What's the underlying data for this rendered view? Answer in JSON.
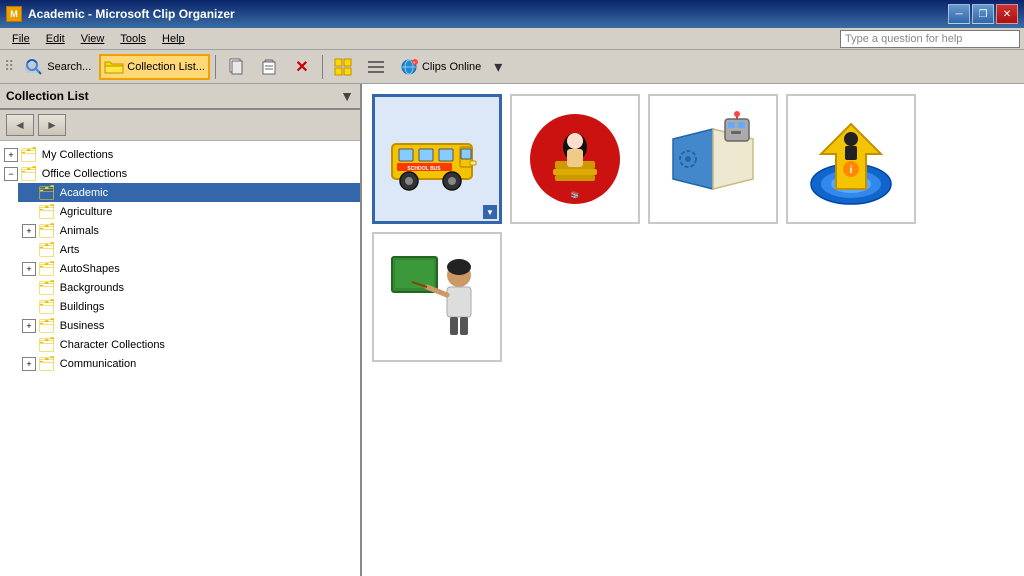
{
  "titlebar": {
    "icon_label": "M",
    "title": "Academic - Microsoft Clip Organizer",
    "minimize_label": "─",
    "restore_label": "❐",
    "close_label": "✕"
  },
  "menubar": {
    "items": [
      "File",
      "Edit",
      "View",
      "Tools",
      "Help"
    ],
    "help_placeholder": "Type a question for help"
  },
  "toolbar": {
    "search_label": "Search...",
    "collection_list_label": "Collection List...",
    "clips_online_label": "Clips Online"
  },
  "sidebar": {
    "title": "Collection List",
    "back_label": "◄",
    "forward_label": "►",
    "tree": [
      {
        "id": "my-collections",
        "label": "My Collections",
        "level": 0,
        "expanded": false,
        "has_children": true
      },
      {
        "id": "office-collections",
        "label": "Office Collections",
        "level": 0,
        "expanded": true,
        "has_children": true
      },
      {
        "id": "academic",
        "label": "Academic",
        "level": 1,
        "expanded": false,
        "has_children": false,
        "selected": true
      },
      {
        "id": "agriculture",
        "label": "Agriculture",
        "level": 1,
        "expanded": false,
        "has_children": false
      },
      {
        "id": "animals",
        "label": "Animals",
        "level": 1,
        "expanded": false,
        "has_children": true
      },
      {
        "id": "arts",
        "label": "Arts",
        "level": 1,
        "expanded": false,
        "has_children": false
      },
      {
        "id": "autoshapes",
        "label": "AutoShapes",
        "level": 1,
        "expanded": false,
        "has_children": true
      },
      {
        "id": "backgrounds",
        "label": "Backgrounds",
        "level": 1,
        "expanded": false,
        "has_children": false
      },
      {
        "id": "buildings",
        "label": "Buildings",
        "level": 1,
        "expanded": false,
        "has_children": false
      },
      {
        "id": "business",
        "label": "Business",
        "level": 1,
        "expanded": false,
        "has_children": true
      },
      {
        "id": "character-collections",
        "label": "Character Collections",
        "level": 1,
        "expanded": false,
        "has_children": false
      },
      {
        "id": "communication",
        "label": "Communication",
        "level": 1,
        "expanded": false,
        "has_children": true
      }
    ]
  },
  "content": {
    "clips": [
      {
        "id": "clip-bus",
        "selected": true,
        "alt": "School bus clip art"
      },
      {
        "id": "clip-apple",
        "selected": false,
        "alt": "Apple with books clip art"
      },
      {
        "id": "clip-book-robot",
        "selected": false,
        "alt": "Book with robot clip art"
      },
      {
        "id": "clip-funnel",
        "selected": false,
        "alt": "Funnel globe clip art"
      },
      {
        "id": "clip-teacher",
        "selected": false,
        "alt": "Teacher clip art"
      }
    ]
  },
  "colors": {
    "accent": "#3366aa",
    "folder": "#e8c000",
    "toolbar_active_border": "#f0a000",
    "toolbar_active_bg": "#ffd878"
  }
}
